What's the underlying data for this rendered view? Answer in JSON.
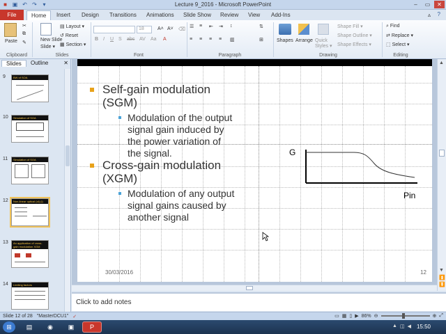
{
  "window": {
    "title": "Lecture 9_2016 - Microsoft PowerPoint"
  },
  "ribbon_tabs": [
    "File",
    "Home",
    "Insert",
    "Design",
    "Transitions",
    "Animations",
    "Slide Show",
    "Review",
    "View",
    "Add-Ins"
  ],
  "ribbon": {
    "clipboard": {
      "paste": "Paste",
      "label": "Clipboard"
    },
    "slides": {
      "new_slide": "New Slide",
      "new_slide_line2": "Slide ▾",
      "layout": "Layout ▾",
      "reset": "Reset",
      "section": "Section ▾",
      "label": "Slides"
    },
    "font": {
      "size": "18",
      "label": "Font",
      "grow": "A˄",
      "shrink": "A˅"
    },
    "paragraph": {
      "label": "Paragraph"
    },
    "drawing": {
      "shapes": "Shapes",
      "arrange": "Arrange",
      "quick_styles": "Quick Styles ▾",
      "shape_fill": "Shape Fill ▾",
      "shape_outline": "Shape Outline ▾",
      "shape_effects": "Shape Effects ▾",
      "label": "Drawing"
    },
    "editing": {
      "find": "Find",
      "replace": "Replace ▾",
      "select": "Select ▾",
      "label": "Editing"
    }
  },
  "left_pane": {
    "tabs": [
      "Slides",
      "Outline"
    ],
    "close": "✕",
    "thumbnails": [
      {
        "num": "9",
        "title": "BW of SOA"
      },
      {
        "num": "10",
        "title": "Simulation of SOA"
      },
      {
        "num": "11",
        "title": "Simulation of SOA"
      },
      {
        "num": "12",
        "title": "Non-linear optical (ol) (i)"
      },
      {
        "num": "13",
        "title": "An application of cross-gain modulation XGM"
      },
      {
        "num": "14",
        "title": "Limiting factors"
      }
    ]
  },
  "slide": {
    "bullets": [
      {
        "line1": "Self-gain modulation",
        "line2": "(SGM)"
      },
      {
        "line1": "Cross-gain modulation",
        "line2": "(XGM)"
      }
    ],
    "sub_bullets": [
      {
        "lines": [
          "Modulation of the output",
          "signal gain induced by",
          "the power variation of",
          "the signal."
        ]
      },
      {
        "lines": [
          "Modulation of any output",
          "signal gains caused by",
          "another signal"
        ]
      }
    ],
    "graph": {
      "y_label": "G",
      "x_label": "Pin"
    },
    "date": "30/03/2016",
    "number": "12"
  },
  "notes": {
    "placeholder": "Click to add notes"
  },
  "status": {
    "slide_info": "Slide 12 of 28",
    "theme": "\"MasterDCU1\"",
    "zoom": "86%"
  },
  "taskbar": {
    "time": "15:50"
  }
}
